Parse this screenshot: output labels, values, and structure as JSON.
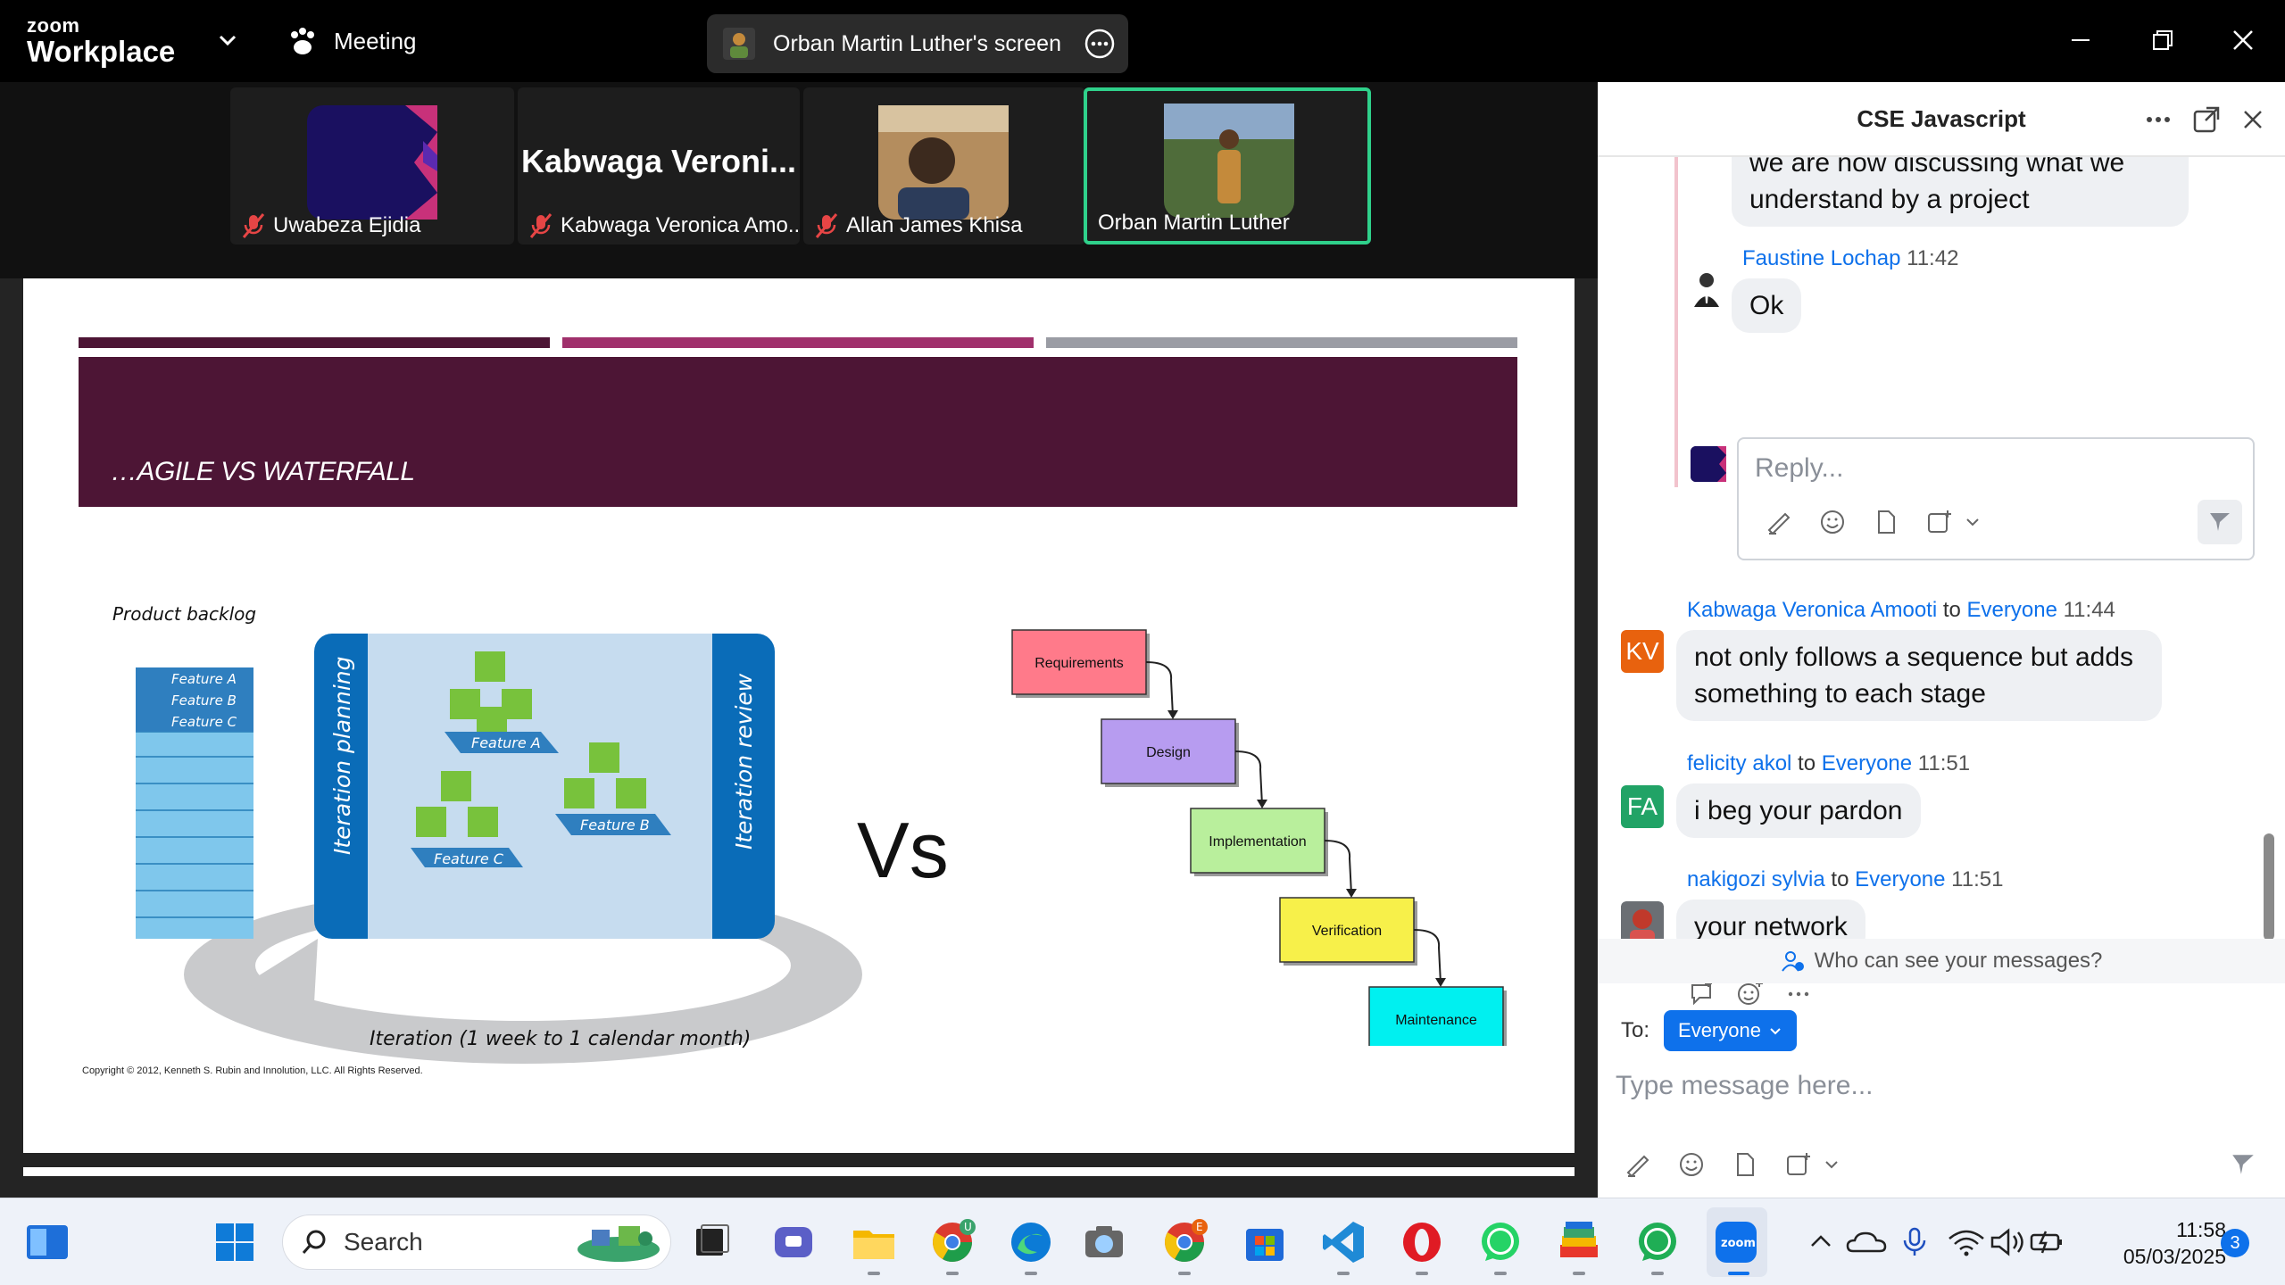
{
  "app": {
    "logo_small": "zoom",
    "logo_big": "Workplace",
    "meeting_label": "Meeting",
    "screen_share_label": "Orban Martin Luther's screen"
  },
  "participants": [
    {
      "name": "Uwabeza Ejidia",
      "muted": true
    },
    {
      "name": "Kabwaga Veronica Amo...",
      "display": "Kabwaga  Veroni...",
      "muted": true
    },
    {
      "name": "Allan James Khisa",
      "muted": true
    },
    {
      "name": "Orban Martin Luther",
      "muted": false,
      "active": true
    }
  ],
  "slide": {
    "title": "…AGILE VS WATERFALL",
    "backlog_label": "Product backlog",
    "backlog_items": [
      "Feature A",
      "Feature B",
      "Feature C"
    ],
    "sides": [
      "Iteration planning",
      "Iteration review"
    ],
    "features": [
      "Feature A",
      "Feature B",
      "Feature C"
    ],
    "iteration_label": "Iteration (1 week to 1 calendar month)",
    "copyright": "Copyright © 2012, Kenneth S. Rubin and Innolution, LLC. All Rights Reserved.",
    "vs": "Vs",
    "waterfall_steps": [
      {
        "label": "Requirements",
        "color": "#ff7a8a"
      },
      {
        "label": "Design",
        "color": "#b79cf0"
      },
      {
        "label": "Implementation",
        "color": "#b9ef9c"
      },
      {
        "label": "Verification",
        "color": "#f7f04a"
      },
      {
        "label": "Maintenance",
        "color": "#00f0f0"
      }
    ],
    "stripe_colors": [
      "#4d1535",
      "#a0306c",
      "#9a9ca4"
    ]
  },
  "chat": {
    "title": "CSE Javascript",
    "messages": {
      "m0_text": "we are now discussing what we understand by a project",
      "m1_sender": "Faustine Lochap",
      "m1_time": "11:42",
      "m1_text": "Ok",
      "reply_placeholder": "Reply...",
      "m2_sender": "Kabwaga Veronica Amooti",
      "m2_to": "to",
      "m2_target": "Everyone",
      "m2_time": "11:44",
      "m2_initials": "KV",
      "m2_text": "not only follows a sequence but adds something to each stage",
      "m3_sender": "felicity akol",
      "m3_to": "to",
      "m3_target": "Everyone",
      "m3_time": "11:51",
      "m3_initials": "FA",
      "m3_text": "i beg your pardon",
      "m4_sender": "nakigozi sylvia",
      "m4_to": "to",
      "m4_target": "Everyone",
      "m4_time": "11:51",
      "m4_text": "your network"
    },
    "who_can_see": "Who can see your messages?",
    "to_label": "To:",
    "to_value": "Everyone",
    "input_placeholder": "Type message here..."
  },
  "taskbar": {
    "search_label": "Search",
    "time": "11:58",
    "date": "05/03/2025",
    "notification_count": "3"
  }
}
